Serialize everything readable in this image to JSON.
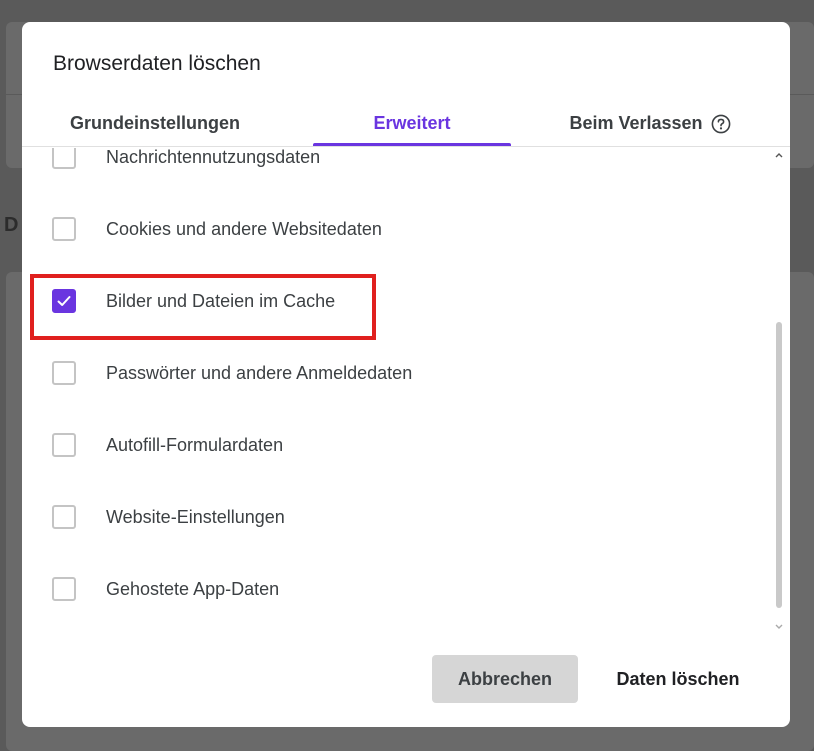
{
  "dialog": {
    "title": "Browserdaten löschen",
    "tabs": [
      {
        "label": "Grundeinstellungen",
        "active": false
      },
      {
        "label": "Erweitert",
        "active": true
      },
      {
        "label": "Beim Verlassen",
        "active": false,
        "icon": "help-circle-icon"
      }
    ],
    "items": [
      {
        "label": "Nachrichtennutzungsdaten",
        "checked": false
      },
      {
        "label": "Cookies und andere Websitedaten",
        "checked": false
      },
      {
        "label": "Bilder und Dateien im Cache",
        "checked": true
      },
      {
        "label": "Passwörter und andere Anmeldedaten",
        "checked": false
      },
      {
        "label": "Autofill-Formulardaten",
        "checked": false
      },
      {
        "label": "Website-Einstellungen",
        "checked": false
      },
      {
        "label": "Gehostete App-Daten",
        "checked": false
      }
    ],
    "buttons": {
      "cancel": "Abbrechen",
      "delete": "Daten löschen"
    }
  },
  "background": {
    "partial_heading": "D"
  },
  "colors": {
    "accent": "#6a35e0",
    "highlight": "#e0201e",
    "overlay": "#5a5a5a"
  }
}
